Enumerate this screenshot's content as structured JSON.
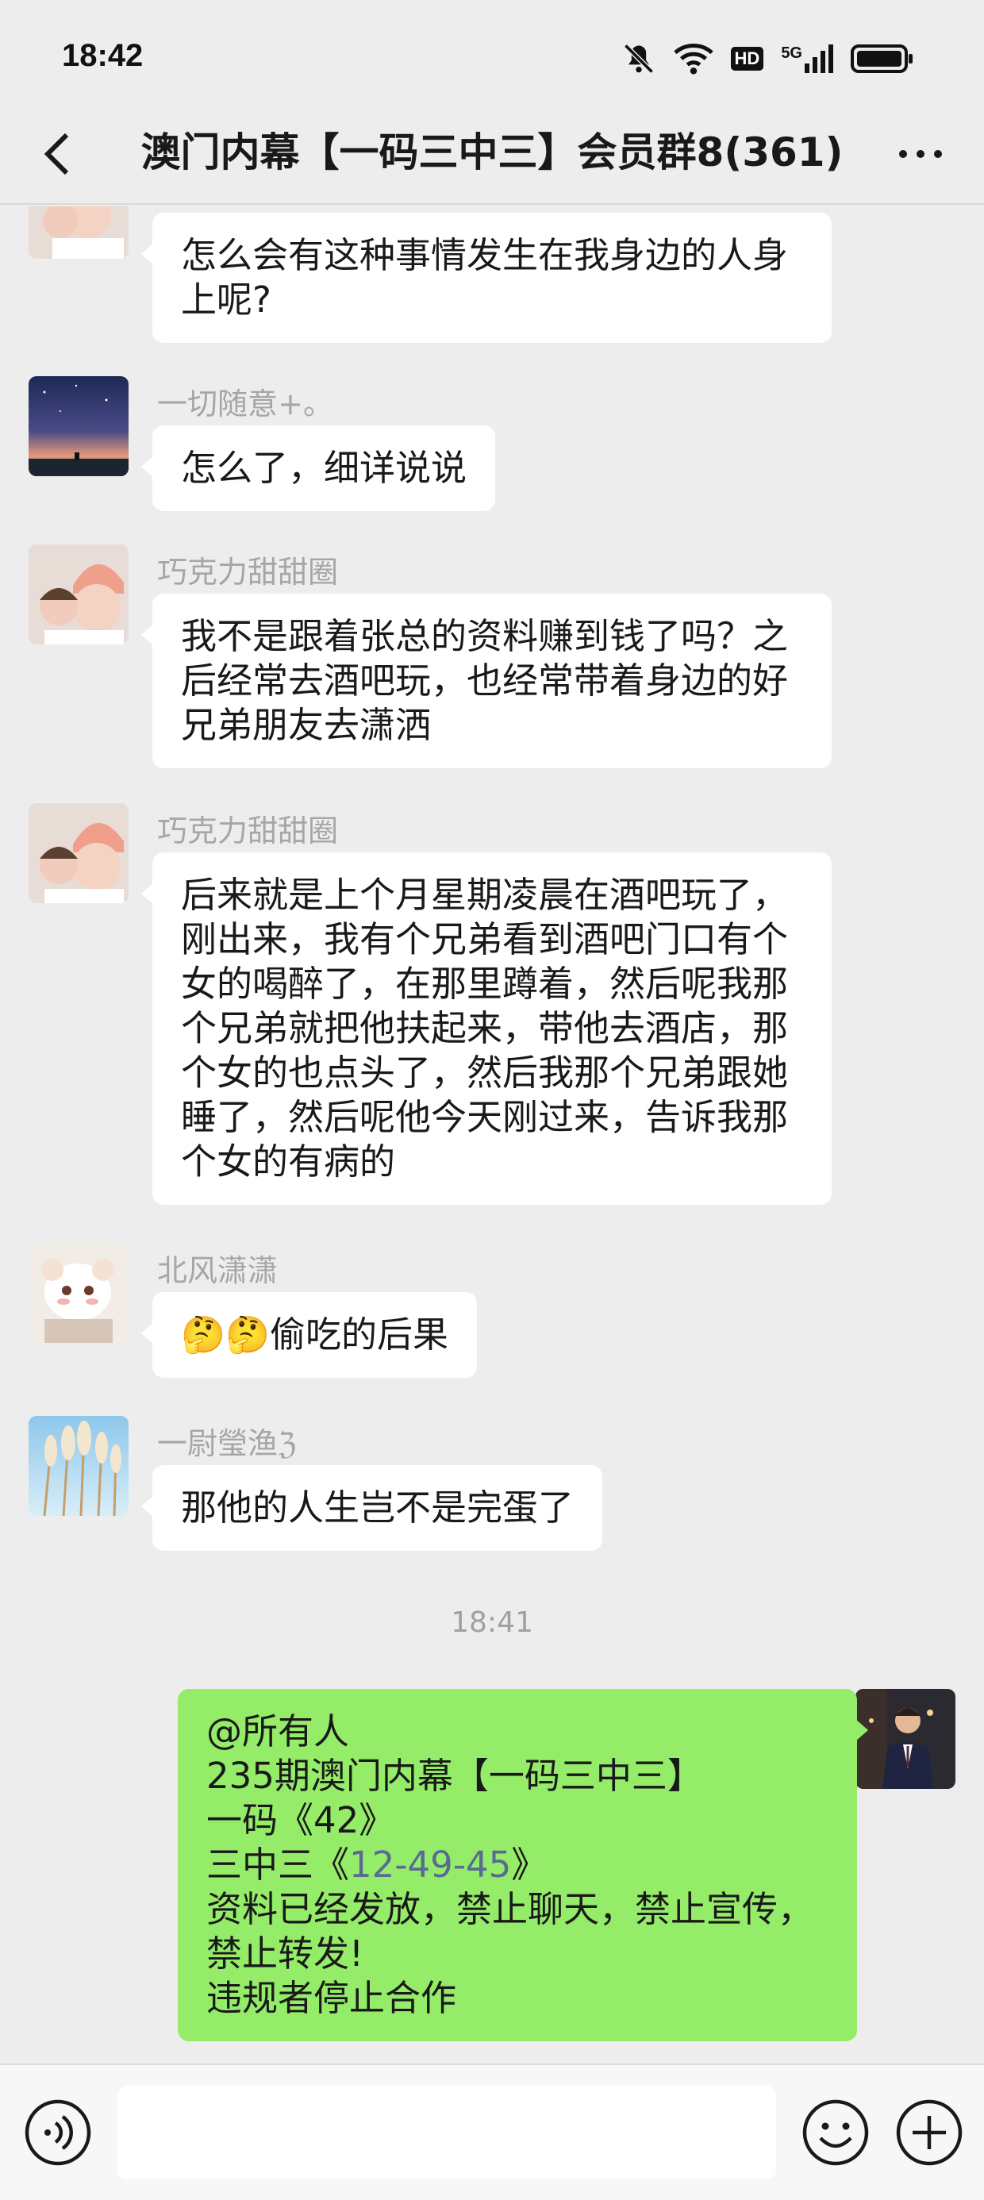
{
  "status_bar": {
    "time": "18:42",
    "network_badge_hd": "HD",
    "network_badge_5g": "5G",
    "icons": [
      "mute-bell-icon",
      "wifi-icon",
      "hd-icon",
      "5g-signal-icon",
      "battery-icon"
    ]
  },
  "header": {
    "title": "澳门内幕【一码三中三】会员群8(361)",
    "back_icon": "chevron-left-icon",
    "more_icon": "more-dots-icon"
  },
  "messages": [
    {
      "sender": "",
      "avatar": "girl-pink-hat",
      "lines": [
        "怎么会有这种事情发生在我身边的人身",
        "上呢?"
      ]
    },
    {
      "sender": "一切随意+。",
      "avatar": "night-sky",
      "lines": [
        "怎么了，细详说说"
      ]
    },
    {
      "sender": "巧克力甜甜圈",
      "avatar": "girl-pink-hat",
      "lines": [
        "我不是跟着张总的资料赚到钱了吗？之",
        "后经常去酒吧玩，也经常带着身边的好",
        "兄弟朋友去潇洒"
      ]
    },
    {
      "sender": "巧克力甜甜圈",
      "avatar": "girl-pink-hat",
      "lines": [
        "后来就是上个月星期凌晨在酒吧玩了，",
        "刚出来，我有个兄弟看到酒吧门口有个",
        "女的喝醉了，在那里蹲着，然后呢我那",
        "个兄弟就把他扶起来，带他去酒店，那",
        "个女的也点头了，然后我那个兄弟跟她",
        "睡了，然后呢他今天刚过来，告诉我那",
        "个女的有病的"
      ]
    },
    {
      "sender": "北风潇潇",
      "avatar": "white-cat",
      "lines": [
        "🤔🤔偷吃的后果"
      ]
    },
    {
      "sender": "一尉瑩渔ℨ",
      "avatar": "reeds-sky",
      "lines": [
        "那他的人生岂不是完蛋了"
      ]
    }
  ],
  "timestamp": "18:41",
  "my_message": {
    "avatar": "man-in-suit",
    "line1": "@所有人",
    "line2": "235期澳门内幕【一码三中三】",
    "line3": "一码《42》",
    "line4_prefix": "三中三《",
    "line4_link": "12-49-45",
    "line4_suffix": "》",
    "line5": "资料已经发放，禁止聊天，禁止宣传，",
    "line6": "禁止转发!",
    "line7": "违规者停止合作"
  },
  "input_bar": {
    "placeholder": "",
    "icons": [
      "voice-icon",
      "emoji-icon",
      "plus-icon"
    ]
  },
  "colors": {
    "background": "#ededed",
    "bubble_in": "#ffffff",
    "bubble_out": "#95ec69",
    "link": "#576b95"
  }
}
